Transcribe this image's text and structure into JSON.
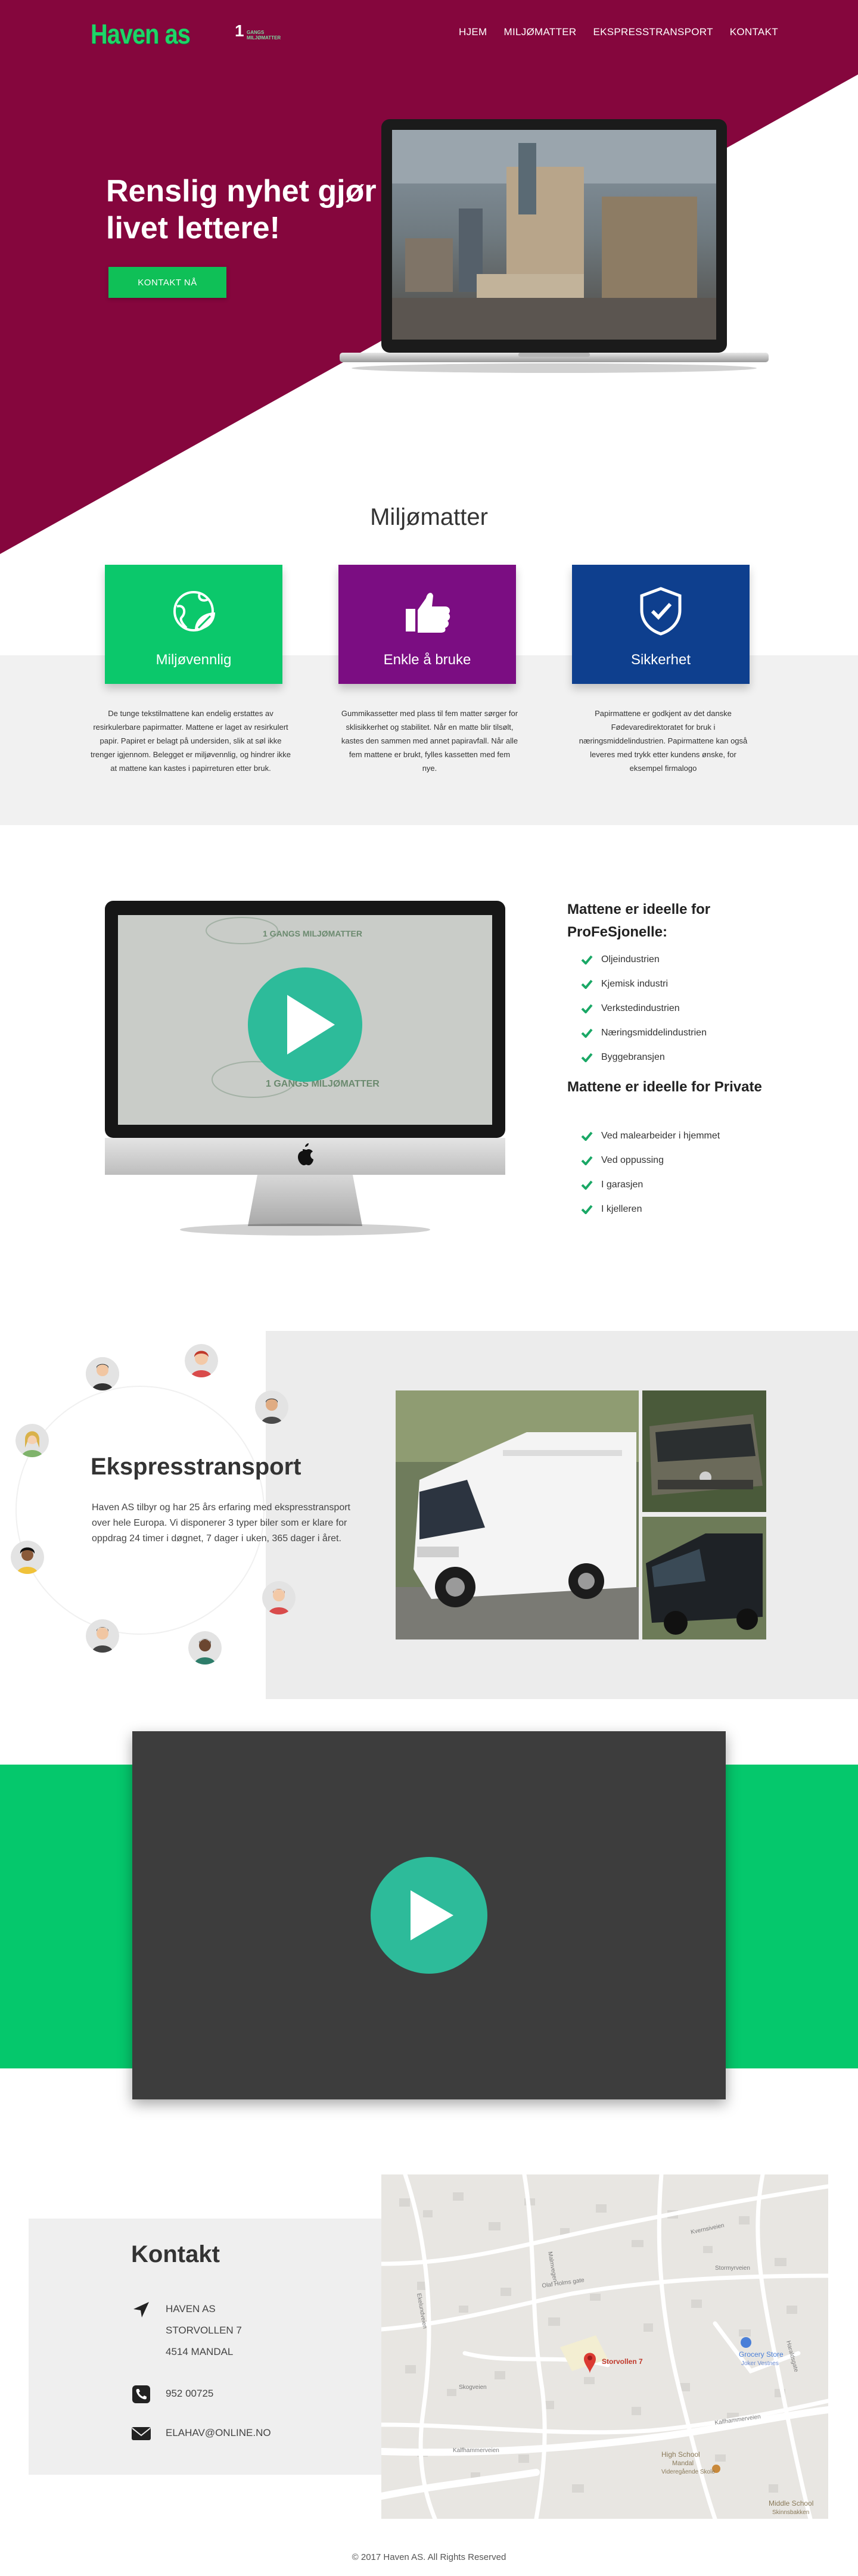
{
  "header": {
    "logo": "Haven as",
    "partner_logo_number": "1",
    "partner_logo_text_1": "GANGS",
    "partner_logo_text_2": "MILJØMATTER",
    "nav": [
      "HJEM",
      "MILJØMATTER",
      "EKSPRESSTRANSPORT",
      "KONTAKT"
    ]
  },
  "hero": {
    "title": "Renslig nyhet gjør livet lettere!",
    "button": "KONTAKT NÅ"
  },
  "features": {
    "title": "Miljømatter",
    "cards": [
      {
        "label": "Miljøvennlig",
        "color": "#0bc86b",
        "icon": "globe-leaf-icon",
        "text": "De tunge tekstilmattene kan endelig erstattes av resirkulerbare papirmatter. Mattene er laget av resirkulert papir. Papiret er belagt på undersiden, slik at søl ikke trenger igjennom. Belegget er miljøvennlig, og hindrer ikke at mattene kan kastes i papirreturen etter bruk."
      },
      {
        "label": "Enkle å bruke",
        "color": "#7b0d82",
        "icon": "thumbs-up-icon",
        "text": "Gummikassetter med plass til fem matter sørger for sklisikkerhet og stabilitet. Når en matte blir tilsølt, kastes den sammen med annet papiravfall. Når alle fem mattene er brukt, fylles kassetten med fem nye."
      },
      {
        "label": "Sikkerhet",
        "color": "#0e3f8e",
        "icon": "shield-check-icon",
        "text": "Papirmattene er godkjent av det danske Fødevaredirektoratet for bruk i næringsmiddelindustrien. Papirmattene kan også leveres med trykk etter kundens ønske, for eksempel firmalogo"
      }
    ]
  },
  "usage": {
    "video_label": "1 GANGS MILJØMATTER",
    "pro_heading": "Mattene er ideelle for ProFeSjonelle:",
    "pro_items": [
      "Oljeindustrien",
      "Kjemisk industri",
      "Verkstedindustrien",
      "Næringsmiddelindustrien",
      "Byggebransjen"
    ],
    "private_heading": "Mattene er ideelle for Private",
    "private_items": [
      "Ved malearbeider i hjemmet",
      "Ved oppussing",
      "I garasjen",
      "I kjelleren"
    ]
  },
  "express": {
    "title": "Ekspresstransport",
    "text": "Haven AS tilbyr og har 25 års erfaring med ekspresstransport over hele Europa. Vi disponerer 3 typer biler som er klare for oppdrag 24 timer i døgnet, 7 dager i uken, 365 dager i året."
  },
  "contact": {
    "title": "Kontakt",
    "address": [
      "HAVEN AS",
      "STORVOLLEN 7",
      "4514 MANDAL"
    ],
    "phone": "952 00725",
    "email": "ELAHAV@ONLINE.NO"
  },
  "map": {
    "pin_label": "Storvollen 7",
    "poi": [
      {
        "label": "Grocery Store"
      },
      {
        "label": "Joker Vestnes"
      },
      {
        "label": "High School"
      },
      {
        "label": "Mandal"
      },
      {
        "label": "Videregående Skole"
      },
      {
        "label": "Middle School"
      },
      {
        "label": "Skinnsbakken"
      }
    ],
    "streets": [
      "Olaf Holms gate",
      "Stormyrveien",
      "Kalfhammerveien",
      "Kalfhammerveien",
      "Kvernsiveien",
      "Skogveien",
      "Malmvegen",
      "Ekelundveien",
      "Haraldsgate"
    ]
  },
  "footer": {
    "text": "© 2017 Haven AS. All Rights Reserved"
  }
}
